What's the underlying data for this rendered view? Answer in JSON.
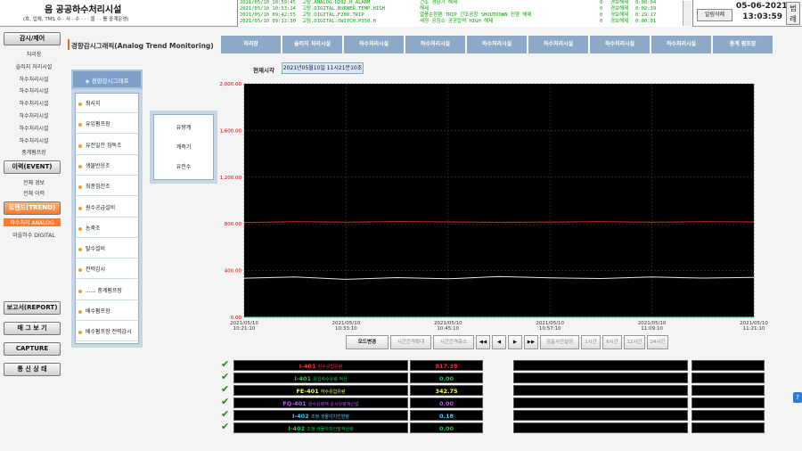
{
  "header": {
    "site_title": "음 공공하수처리시설",
    "site_sub": "(흐, 업체, TMS 수 · 사 · 수 · · · 을 · · 를 중계운영)",
    "date": "05-06-2021",
    "time": "13:03:59",
    "alarm_ack_button": "알림삭제",
    "legend_button": "범례"
  },
  "alarms": [
    {
      "time": "2021/05/10 10:59:45",
      "tag": "고탐.ANALOG.D202.H_ALARM",
      "desc": "건조 경향기 해제",
      "count": "0",
      "state": "경보해제",
      "dur": "0:00:04"
    },
    {
      "time": "2021/05/10 10:53:14",
      "tag": "고탐.DIGITAL.BURNER.TEMP.HIGH",
      "desc": "해제",
      "count": "0",
      "state": "경보해제",
      "dur": "0:02:39"
    },
    {
      "time": "2021/05/10 09:42:55",
      "tag": "고탐.DIGITAL.F200.TRIP",
      "desc": "열풍순환팬 TRIP 건조공장 SHOUTDOWN 진행 해제",
      "count": "0",
      "state": "경보해제",
      "dur": "0:29:17"
    },
    {
      "time": "2021/05/10 09:13:30",
      "tag": "고탐.DIGITAL.SWITCH.P350.H",
      "desc": "세정 공정소 공공압력 HIGH 해제",
      "count": "0",
      "state": "경보해제",
      "dur": "0:00:01"
    }
  ],
  "sidebar": {
    "buttons": {
      "monitor": "감시/제어",
      "event": "이력(EVENT)",
      "trend": "트렌드(TREND)",
      "report": "보고서(REPORT)",
      "manual": "매 그 보 기",
      "capture": "CAPTURE",
      "comm": "통 신 상 태"
    },
    "monitor_items": [
      "처리장",
      "슬러지 처리시설",
      "하수처리시설",
      "하수처리시설",
      "하수처리시설",
      "하수처리시설",
      "하수처리시설",
      "하수처리시설",
      "중계펌프장"
    ],
    "event_items": [
      "전체 경보",
      "전체 이력"
    ],
    "trend_items": [
      "하수처리 ANALOG",
      "마을하수 DIGITAL"
    ]
  },
  "page": {
    "title": "경향감시그래픽(Analog Trend Monitoring)",
    "current_time_label": "현재시각",
    "current_time_value": "2021년05월10일 11시21분10초"
  },
  "tabs": [
    "처리장",
    "슬러지 처리시설",
    "하수처리시설",
    "하수처리시설",
    "하수처리시설",
    "하수처리시설",
    "하수처리시설",
    "하수처리시설",
    "중계 펌프장"
  ],
  "menu": {
    "header": "◈ 경향감시그래프",
    "items": [
      "최사지",
      "유입펌프장",
      "유전일잔 침독조",
      "생물반응조",
      "최종침전조",
      "원수공급설비",
      "농축조",
      "탈수설비",
      "전력감시",
      "...... 중계펌프장",
      "배수펌프장",
      "배수펌프장 전력감시"
    ],
    "submenu": [
      "유량계",
      "계측기",
      "유전수"
    ]
  },
  "controls": [
    "모드변경",
    "시간간격확대",
    "시간간격축소",
    "◀◀",
    "◀",
    "▶",
    "▶▶",
    "검출시간설정",
    "1시간",
    "6시간",
    "12시간",
    "24시간"
  ],
  "table": [
    {
      "tag": "I-401",
      "desc": "원수유입유량",
      "value": "817.38",
      "color": "#ff2a2a"
    },
    {
      "tag": "I-401",
      "desc": "유입하수유량 적산",
      "value": "0.00",
      "color": "#23c25a"
    },
    {
      "tag": "FE-401",
      "desc": "하수유입유량",
      "value": "342.75",
      "color": "#ffff40"
    },
    {
      "tag": "FQ-401",
      "desc": "원수유량계 순시유량적산값",
      "value": "0.00",
      "color": "#c050ff"
    },
    {
      "tag": "I-402",
      "desc": "조정 생물아치인발량",
      "value": "0.18",
      "color": "#40c8ff"
    },
    {
      "tag": "I-402",
      "desc": "조정 생물아치인발적산량",
      "value": "0.00",
      "color": "#23c25a"
    }
  ],
  "chart_data": {
    "type": "line",
    "x": [
      "2021/05/10 10:21:10",
      "2021/05/10 10:33:10",
      "2021/05/10 10:45:10",
      "2021/05/10 10:57:10",
      "2021/05/10 11:09:10",
      "2021/05/10 11:21:10"
    ],
    "ylim": [
      0,
      2000
    ],
    "yticks": [
      "0.00",
      "400.00",
      "800.00",
      "1,200.00",
      "1,600.00",
      "2,000.00"
    ],
    "grid": true,
    "series": [
      {
        "color": "#d83020",
        "values": [
          812,
          818,
          815,
          820,
          817,
          814,
          816,
          819,
          815,
          818,
          817
        ]
      },
      {
        "color": "#e8e8d8",
        "values": [
          335,
          345,
          325,
          340,
          330,
          350,
          338,
          332,
          345,
          336,
          342
        ]
      },
      {
        "color": "#23c25a",
        "values": [
          2,
          2,
          2,
          2,
          2,
          2,
          2,
          2,
          2,
          2,
          2
        ]
      }
    ]
  }
}
